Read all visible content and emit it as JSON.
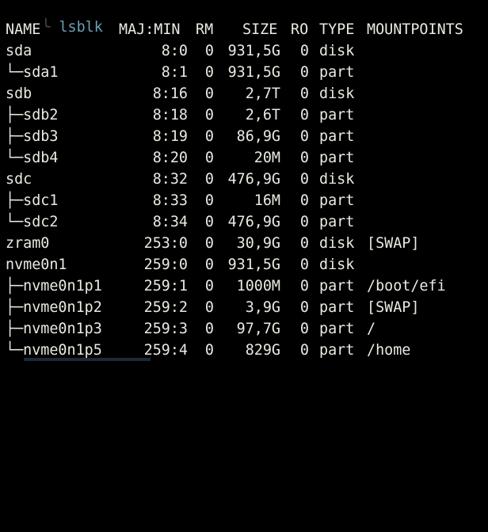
{
  "prompt": {
    "connector": "╰ ",
    "command": "lsblk"
  },
  "table": {
    "headers": {
      "name": "NAME",
      "majmin": "MAJ:MIN",
      "rm": "RM",
      "size": "SIZE",
      "ro": "RO",
      "type": "TYPE",
      "mountpoints": "MOUNTPOINTS"
    },
    "rows": [
      {
        "name": "sda",
        "majmin": "8:0",
        "rm": "0",
        "size": "931,5G",
        "ro": "0",
        "type": "disk",
        "mountpoints": ""
      },
      {
        "name": "└─sda1",
        "majmin": "8:1",
        "rm": "0",
        "size": "931,5G",
        "ro": "0",
        "type": "part",
        "mountpoints": ""
      },
      {
        "name": "sdb",
        "majmin": "8:16",
        "rm": "0",
        "size": "2,7T",
        "ro": "0",
        "type": "disk",
        "mountpoints": ""
      },
      {
        "name": "├─sdb2",
        "majmin": "8:18",
        "rm": "0",
        "size": "2,6T",
        "ro": "0",
        "type": "part",
        "mountpoints": ""
      },
      {
        "name": "├─sdb3",
        "majmin": "8:19",
        "rm": "0",
        "size": "86,9G",
        "ro": "0",
        "type": "part",
        "mountpoints": ""
      },
      {
        "name": "└─sdb4",
        "majmin": "8:20",
        "rm": "0",
        "size": "20M",
        "ro": "0",
        "type": "part",
        "mountpoints": ""
      },
      {
        "name": "sdc",
        "majmin": "8:32",
        "rm": "0",
        "size": "476,9G",
        "ro": "0",
        "type": "disk",
        "mountpoints": ""
      },
      {
        "name": "├─sdc1",
        "majmin": "8:33",
        "rm": "0",
        "size": "16M",
        "ro": "0",
        "type": "part",
        "mountpoints": ""
      },
      {
        "name": "└─sdc2",
        "majmin": "8:34",
        "rm": "0",
        "size": "476,9G",
        "ro": "0",
        "type": "part",
        "mountpoints": ""
      },
      {
        "name": "zram0",
        "majmin": "253:0",
        "rm": "0",
        "size": "30,9G",
        "ro": "0",
        "type": "disk",
        "mountpoints": "[SWAP]"
      },
      {
        "name": "nvme0n1",
        "majmin": "259:0",
        "rm": "0",
        "size": "931,5G",
        "ro": "0",
        "type": "disk",
        "mountpoints": ""
      },
      {
        "name": "├─nvme0n1p1",
        "majmin": "259:1",
        "rm": "0",
        "size": "1000M",
        "ro": "0",
        "type": "part",
        "mountpoints": "/boot/efi"
      },
      {
        "name": "├─nvme0n1p2",
        "majmin": "259:2",
        "rm": "0",
        "size": "3,9G",
        "ro": "0",
        "type": "part",
        "mountpoints": "[SWAP]"
      },
      {
        "name": "├─nvme0n1p3",
        "majmin": "259:3",
        "rm": "0",
        "size": "97,7G",
        "ro": "0",
        "type": "part",
        "mountpoints": "/"
      },
      {
        "name": "└─nvme0n1p5",
        "majmin": "259:4",
        "rm": "0",
        "size": "829G",
        "ro": "0",
        "type": "part",
        "mountpoints": "/home"
      }
    ]
  },
  "colors": {
    "background": "#000000",
    "text": "#ebe9e1",
    "command": "#6a9fb5",
    "connector": "#4e4e4e"
  }
}
